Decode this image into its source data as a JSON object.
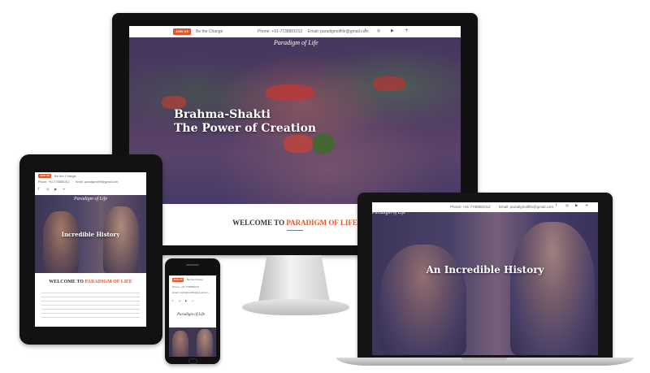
{
  "site": {
    "badge": "JOIN US",
    "tagline": "Be the Change",
    "phone": "Phone: +91-7738881012",
    "email": "Email: paradigmoflife@gmail.com",
    "logo": "Paradigm of Life",
    "hero_line1": "Brahma-Shakti",
    "hero_line2": "The Power of Creation",
    "slide_history": "An Incredible History",
    "slide_history_short": "Incredible History",
    "welcome_prefix": "WELCOME TO ",
    "welcome_brand": "PARADIGM OF LIFE",
    "social_icons": [
      "facebook-icon",
      "instagram-icon",
      "youtube-icon",
      "plus-icon"
    ]
  },
  "colors": {
    "accent": "#e2572c",
    "hero_overlay": "#3b3470",
    "device_bezel": "#111111"
  }
}
